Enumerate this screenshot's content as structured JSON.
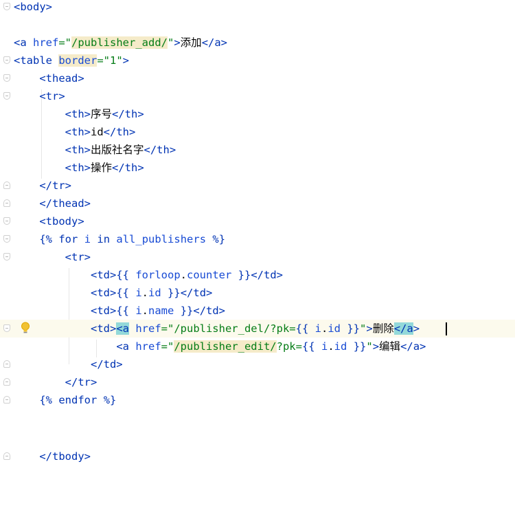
{
  "editor": {
    "lines": [
      "<body>",
      "",
      "<a href=\"/publisher_add/\">添加</a>",
      "<table border=\"1\">",
      "<thead>",
      "<tr>",
      "<th>序号</th>",
      "<th>id</th>",
      "<th>出版社名字</th>",
      "<th>操作</th>",
      "</tr>",
      "</thead>",
      "<tbody>",
      "{% for i in all_publishers %}",
      "<tr>",
      "<td>{{ forloop.counter }}</td>",
      "<td>{{ i.id }}</td>",
      "<td>{{ i.name }}</td>",
      "<td><a href=\"/publisher_del/?pk={{ i.id }}\">删除</a>",
      "<a href=\"/publisher_edit/?pk={{ i.id }}\">编辑</a>",
      "</td>",
      "</tr>",
      "{% endfor %}",
      "",
      "",
      "</tbody>"
    ],
    "current_line_index": 18,
    "icons": {
      "fold_marker": "fold-marker-icon",
      "intention": "lightbulb-icon"
    },
    "colors": {
      "tag": "#0033b3",
      "attribute": "#174ad4",
      "string": "#067d17",
      "template_variable": "#871094",
      "current_line": "#fcfaed",
      "brace_match": "#93d9d9",
      "attribute_highlight": "#f5ebc9"
    }
  }
}
